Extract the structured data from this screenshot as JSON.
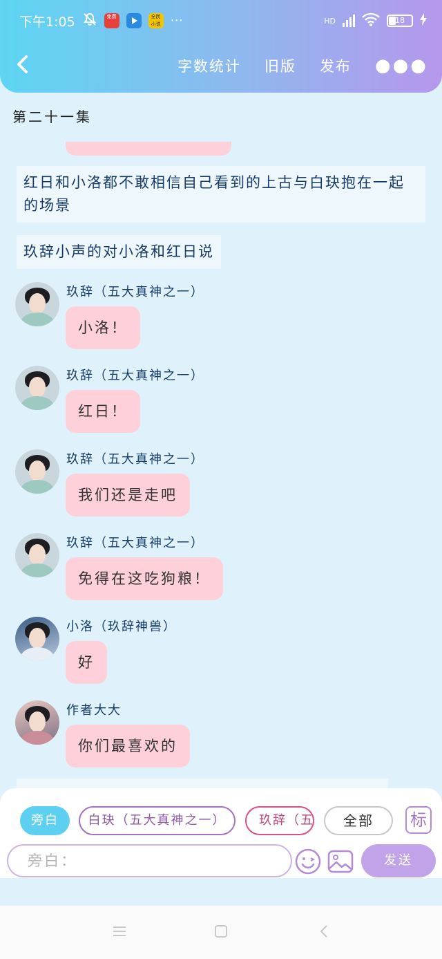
{
  "status_bar": {
    "time": "下午1:05",
    "app_icons": [
      "baidu-app-icon",
      "video-app-icon",
      "novel-app-icon"
    ],
    "app_icon_labels": [
      "免费",
      "",
      "全民\n小说"
    ],
    "overflow": "···",
    "network": "HD",
    "battery": "18"
  },
  "nav": {
    "word_count": "字数统计",
    "old_version": "旧版",
    "publish": "发布",
    "more": "●●●"
  },
  "chapter_title": "第二十一集",
  "narrations": [
    "红日和小洛都不敢相信自己看到的上古与白玦抱在一起的场景",
    "玖辞小声的对小洛和红日说"
  ],
  "messages": [
    {
      "speaker": "玖辞（五大真神之一）",
      "text": "小洛！"
    },
    {
      "speaker": "玖辞（五大真神之一）",
      "text": "红日！"
    },
    {
      "speaker": "玖辞（五大真神之一）",
      "text": "我们还是走吧"
    },
    {
      "speaker": "玖辞（五大真神之一）",
      "text": "免得在这吃狗粮！"
    },
    {
      "speaker": "小洛（玖辞神兽）",
      "text": "好"
    },
    {
      "speaker": "作者大大",
      "text": "你们最喜欢的"
    }
  ],
  "composer": {
    "roles": [
      "旁白",
      "白玦（五大真神之一）",
      "玖辞（五"
    ],
    "all_label": "全部",
    "tag_label": "标",
    "input_placeholder": "旁白：",
    "send_label": "发送"
  },
  "colors": {
    "header_start": "#5dd5f3",
    "header_end": "#b697ec",
    "bubble": "#fdd0da",
    "page_bg": "#dff2fb",
    "speaker_text": "#173c6b"
  }
}
